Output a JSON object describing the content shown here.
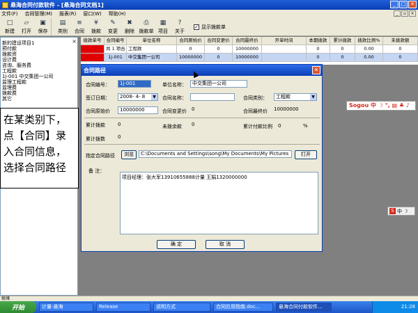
{
  "window": {
    "title": "悬海合同付款软件 - [悬海合同文档1]"
  },
  "menu": [
    "文件(F)",
    "合同管理(M)",
    "报表(R)",
    "窗口(W)",
    "帮助(H)"
  ],
  "toolbar": [
    {
      "label": "新建",
      "icon": "new-icon",
      "glyph": "□"
    },
    {
      "label": "打开",
      "icon": "open-icon",
      "glyph": "▱"
    },
    {
      "label": "保存",
      "icon": "save-icon",
      "glyph": "▣"
    },
    {
      "label": "类别",
      "icon": "category-icon",
      "glyph": "▤"
    },
    {
      "label": "合同",
      "icon": "contract-icon",
      "glyph": "≡"
    },
    {
      "label": "拨款",
      "icon": "payment-icon",
      "glyph": "¥"
    },
    {
      "label": "变更",
      "icon": "change-icon",
      "glyph": "✎"
    },
    {
      "label": "删除",
      "icon": "delete-icon",
      "glyph": "✖"
    },
    {
      "label": "拨款单",
      "icon": "print-icon",
      "glyph": "⎙"
    },
    {
      "label": "项目",
      "icon": "project-icon",
      "glyph": "▦"
    },
    {
      "label": "关于",
      "icon": "help-icon",
      "glyph": "?"
    }
  ],
  "show_payment": {
    "label": "显示拨款单",
    "checked": true
  },
  "tree": [
    "新的建设项目1",
    "  预付款",
    "  拨款资",
    "  设计费",
    "  咨询、服务费",
    "  工程款",
    "    1j-001 中交集团一公司",
    "  监理工程款",
    "  监理费",
    "  拨款费",
    "  其它"
  ],
  "callout": [
    "在某类别下，",
    "点【合同】录",
    "入合同信息，",
    "选择合同路径"
  ],
  "grid": {
    "headers": [
      "拨款单号",
      "合同编号",
      "单位名称",
      "合同原始价",
      "合同变更价",
      "合同最终价",
      "开单时间",
      "本期拨款",
      "累计拨款",
      "拨款比例%",
      "未拨款额"
    ],
    "rows": [
      [
        "",
        "共 1 项合",
        "工程款",
        "0",
        "0",
        "10000000",
        "",
        "0",
        "0",
        "0.00",
        "0"
      ],
      [
        "",
        "1j-001",
        "中交集团一公司",
        "10000000",
        "0",
        "10000000",
        "",
        "0",
        "0",
        "0.00",
        "0"
      ]
    ]
  },
  "dialog": {
    "title": "合同路径",
    "contract_no_label": "合同编号：",
    "contract_no": "1j-001",
    "unit_label": "单位名称：",
    "unit": "中交集团一公司",
    "date_label": "签订日期：",
    "date": "2008- 4- 8",
    "name_label": "合同名称：",
    "name": "",
    "type_label": "合同类别：",
    "type": "工程款",
    "orig_label": "合同原始价",
    "orig": "10000000",
    "change_label": "合同变更价",
    "change": "0",
    "final_label": "合同最终价",
    "final": "10000000",
    "paid_label": "累计拨款",
    "paid": "0",
    "unpaid_label": "未拨余款",
    "unpaid": "0",
    "ratio_label": "累计付款比例",
    "ratio": "0",
    "pct": "%",
    "count_label": "累计拨数",
    "count": "0",
    "path_label": "指定合同路径",
    "browse": "浏览",
    "path": "C:\\Documents and Settings\\song\\My Documents\\My Pictures",
    "open": "打开",
    "memo_label": "备  注：",
    "memo": "项目经理：张大军13910655888计量 王娟1320000000",
    "ok": "确  定",
    "cancel": "取  消"
  },
  "sogou": {
    "bar1": "Sogou 中 ☽ °, ▤ ♣ ♪",
    "bar2_s": "S",
    "bar2_k": "中 ☽"
  },
  "status": "就绪",
  "taskbar": {
    "start": "开始",
    "tasks": [
      "计量-悬海",
      "Release",
      "说明方式",
      "合同应用指南.doc...",
      "悬海合同付款软件..."
    ],
    "clock": "21:28"
  }
}
